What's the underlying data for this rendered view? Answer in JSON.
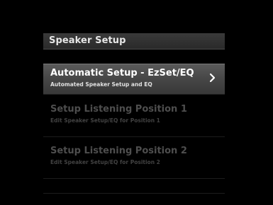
{
  "menu": {
    "title": "Speaker Setup",
    "items": [
      {
        "title": "Automatic Setup - EzSet/EQ",
        "subtitle": "Automated Speaker Setup and EQ",
        "selected": true,
        "icon": "chevron-right-icon"
      },
      {
        "title": "Setup Listening Position 1",
        "subtitle": "Edit Speaker Setup/EQ for Position 1",
        "selected": false
      },
      {
        "title": "Setup Listening Position 2",
        "subtitle": "Edit Speaker Setup/EQ for Position 2",
        "selected": false
      }
    ]
  },
  "colors": {
    "background": "#000000",
    "highlight": "#4a4a4a",
    "text_active": "#ffffff",
    "text_dim": "#4e4e4e"
  }
}
